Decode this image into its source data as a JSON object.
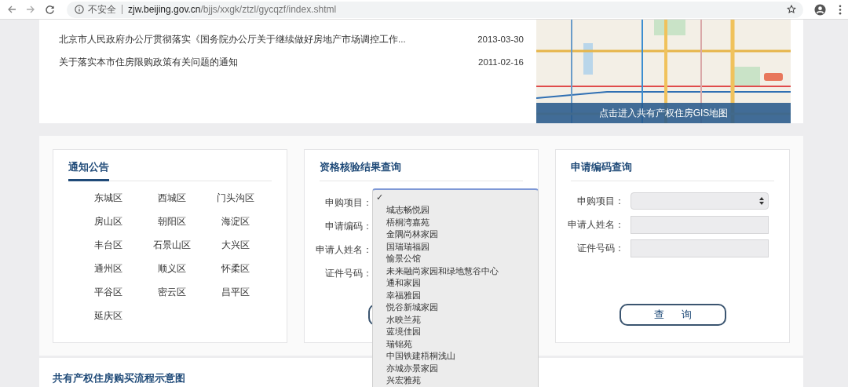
{
  "browser": {
    "security": "不安全",
    "url_host": "zjw.beijing.gov.cn",
    "url_path": "/bjjs/xxgk/ztzl/gycqzf/index.shtml"
  },
  "news": [
    {
      "title": "北京市人民政府办公厅贯彻落实《国务院办公厅关于继续做好房地产市场调控工作...",
      "date": "2013-03-30"
    },
    {
      "title": "关于落实本市住房限购政策有关问题的通知",
      "date": "2011-02-16"
    }
  ],
  "map": {
    "kind": "picture",
    "caption": "点击进入共有产权住房GIS地图"
  },
  "notice": {
    "title": "通知公告",
    "districts": [
      "东城区",
      "西城区",
      "门头沟区",
      "房山区",
      "朝阳区",
      "海淀区",
      "丰台区",
      "石景山区",
      "大兴区",
      "通州区",
      "顺义区",
      "怀柔区",
      "平谷区",
      "密云区",
      "昌平区",
      "延庆区"
    ]
  },
  "qualification_query": {
    "title": "资格核验结果查询",
    "fields": [
      {
        "label": "申购项目："
      },
      {
        "label": "申请编码："
      },
      {
        "label": "申请人姓名："
      },
      {
        "label": "证件号码："
      }
    ],
    "dropdown": {
      "blank_option": {
        "selected": true,
        "check": "✓"
      },
      "options": [
        {
          "label": "城志畅悦园",
          "selected": false
        },
        {
          "label": "梧桐湾嘉苑",
          "selected": false
        },
        {
          "label": "金隅尚林家园",
          "selected": false
        },
        {
          "label": "国瑞瑞福园",
          "selected": false
        },
        {
          "label": "愉景公馆",
          "selected": false
        },
        {
          "label": "未来融尚家园和绿地慧谷中心",
          "selected": false
        },
        {
          "label": "通和家园",
          "selected": false
        },
        {
          "label": "幸福雅园",
          "selected": false
        },
        {
          "label": "悦谷新城家园",
          "selected": false
        },
        {
          "label": "水映兰苑",
          "selected": false
        },
        {
          "label": "蓝境佳园",
          "selected": false
        },
        {
          "label": "瑞锦苑",
          "selected": false
        },
        {
          "label": "中国铁建梧桐浅山",
          "selected": false
        },
        {
          "label": "亦城亦景家园",
          "selected": false
        },
        {
          "label": "兴宏雅苑",
          "selected": false
        }
      ]
    }
  },
  "code_query": {
    "title": "申请编码查询",
    "fields": [
      {
        "label": "申购项目：",
        "kind": "select"
      },
      {
        "label": "申请人姓名：",
        "kind": "text"
      },
      {
        "label": "证件号码：",
        "kind": "text"
      }
    ],
    "button": "查      询"
  },
  "process": {
    "title": "共有产权住房购买流程示意图"
  }
}
